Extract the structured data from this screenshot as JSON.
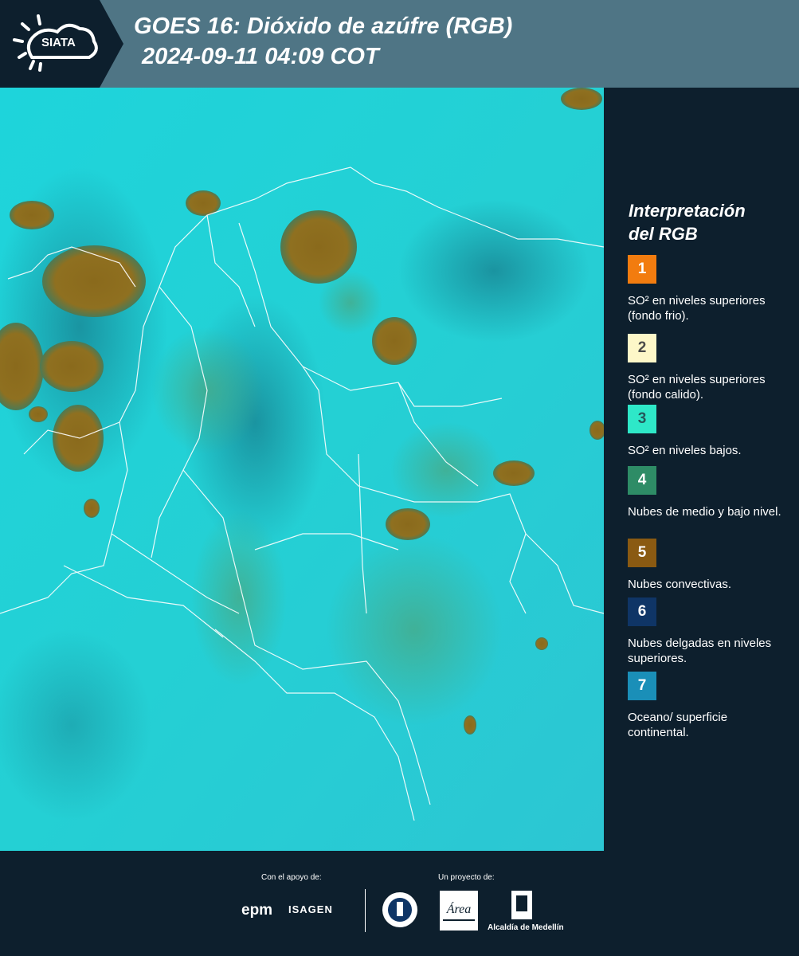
{
  "header": {
    "logo_text": "SIATA",
    "title_line1": "GOES 16: Dióxido de azúfre (RGB)",
    "title_line2": "2024-09-11 04:09 COT"
  },
  "legend": {
    "title_line1": "Interpretación",
    "title_line2": "del RGB",
    "items": [
      {
        "number": "1",
        "color": "#f27c0f",
        "label": "SO² en niveles superiores (fondo frio)."
      },
      {
        "number": "2",
        "color": "#fdf7c8",
        "label": "SO² en niveles superiores (fondo calido)."
      },
      {
        "number": "3",
        "color": "#2ee8c8",
        "label": "SO² en niveles bajos."
      },
      {
        "number": "4",
        "color": "#2e8c66",
        "label": "Nubes de medio y bajo nivel."
      },
      {
        "number": "5",
        "color": "#8a5a12",
        "label": "Nubes convectivas."
      },
      {
        "number": "6",
        "color": "#0f3566",
        "label": "Nubes delgadas en niveles superiores."
      },
      {
        "number": "7",
        "color": "#1a8fb8",
        "label": "Oceano/ superficie continental."
      }
    ]
  },
  "footer": {
    "support_label": "Con el apoyo de:",
    "project_label": "Un proyecto de:",
    "sponsor1": "epm",
    "sponsor2": "ISAGEN",
    "area_logo_text": "Área Metropolitana Valle de Aburrá",
    "alcaldia": "Alcaldía de Medellín"
  },
  "colors": {
    "header_bg": "#4f7585",
    "panel_bg": "#0d1f2d",
    "map_base": "#1fcfd6",
    "convective_cloud": "#8a6a1c",
    "low_cloud": "#3aa58c"
  }
}
